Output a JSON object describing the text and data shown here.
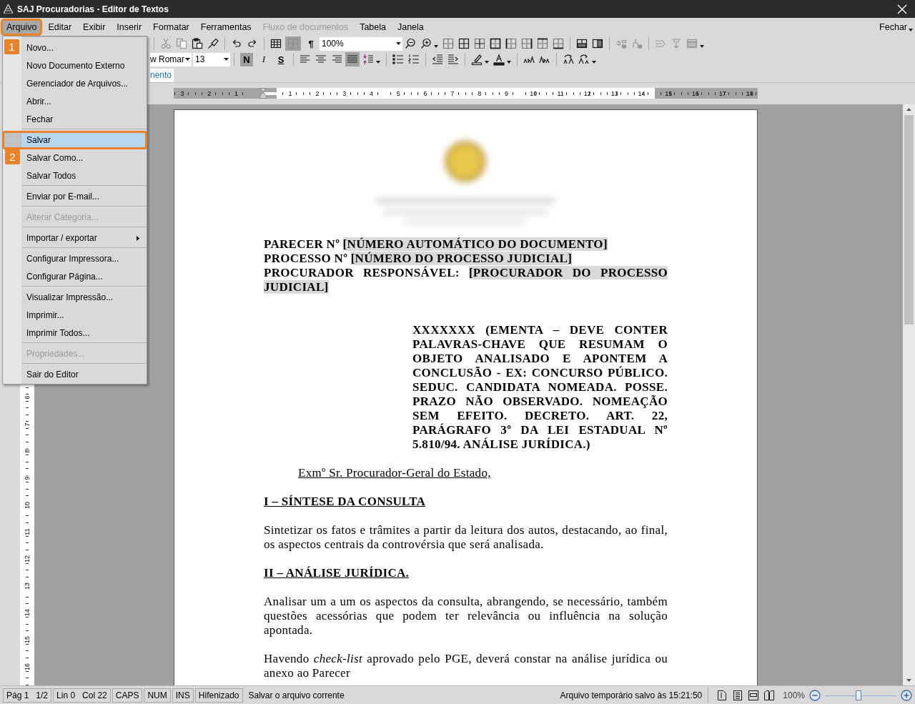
{
  "window": {
    "title": "SAJ Procuradorias - Editor de Textos"
  },
  "menus": [
    {
      "label": "Arquivo",
      "selected": true,
      "disabled": false,
      "callout": "1"
    },
    {
      "label": "Editar",
      "selected": false,
      "disabled": false
    },
    {
      "label": "Exibir",
      "selected": false,
      "disabled": false
    },
    {
      "label": "Inserir",
      "selected": false,
      "disabled": false
    },
    {
      "label": "Formatar",
      "selected": false,
      "disabled": false
    },
    {
      "label": "Ferramentas",
      "selected": false,
      "disabled": false
    },
    {
      "label": "Fluxo de documentos",
      "selected": false,
      "disabled": true
    },
    {
      "label": "Tabela",
      "selected": false,
      "disabled": false
    },
    {
      "label": "Janela",
      "selected": false,
      "disabled": false
    }
  ],
  "close_document": "Fechar",
  "file_menu": {
    "groups": [
      {
        "items": [
          {
            "label": "Novo...",
            "selected": false,
            "disabled": false,
            "submenu": false
          },
          {
            "label": "Novo Documento Externo",
            "selected": false,
            "disabled": false,
            "submenu": false
          },
          {
            "label": "Gerenciador de Arquivos...",
            "selected": false,
            "disabled": false,
            "submenu": false
          },
          {
            "label": "Abrir...",
            "selected": false,
            "disabled": false,
            "submenu": false
          },
          {
            "label": "Fechar",
            "selected": false,
            "disabled": false,
            "submenu": false
          }
        ]
      },
      {
        "items": [
          {
            "label": "Salvar",
            "selected": true,
            "disabled": false,
            "submenu": false,
            "callout": "2"
          },
          {
            "label": "Salvar Como...",
            "selected": false,
            "disabled": false,
            "submenu": false
          },
          {
            "label": "Salvar Todos",
            "selected": false,
            "disabled": false,
            "submenu": false
          }
        ]
      },
      {
        "items": [
          {
            "label": "Enviar por E-mail...",
            "selected": false,
            "disabled": false,
            "submenu": false
          }
        ]
      },
      {
        "items": [
          {
            "label": "Alterar Categoria...",
            "selected": false,
            "disabled": true,
            "submenu": false
          }
        ]
      },
      {
        "items": [
          {
            "label": "Importar / exportar",
            "selected": false,
            "disabled": false,
            "submenu": true
          }
        ]
      },
      {
        "items": [
          {
            "label": "Configurar Impressora...",
            "selected": false,
            "disabled": false,
            "submenu": false
          },
          {
            "label": "Configurar Página...",
            "selected": false,
            "disabled": false,
            "submenu": false
          }
        ]
      },
      {
        "items": [
          {
            "label": "Visualizar Impressão...",
            "selected": false,
            "disabled": false,
            "submenu": false
          },
          {
            "label": "Imprimir...",
            "selected": false,
            "disabled": false,
            "submenu": false
          },
          {
            "label": "Imprimir Todos...",
            "selected": false,
            "disabled": false,
            "submenu": false
          }
        ]
      },
      {
        "items": [
          {
            "label": "Propriedades...",
            "selected": false,
            "disabled": true,
            "submenu": false
          }
        ]
      },
      {
        "items": [
          {
            "label": "Sair do Editor",
            "selected": false,
            "disabled": false,
            "submenu": false
          }
        ]
      }
    ]
  },
  "toolbar": {
    "edit_buttons": [
      {
        "disabled": true
      },
      {
        "disabled": true
      },
      {
        "disabled": false
      },
      {
        "disabled": false
      }
    ],
    "grid_button": {
      "pressed": true
    },
    "pilcrow": {
      "label": "¶",
      "pressed": false
    },
    "zoom": "100%",
    "table_tools": [
      {
        "disabled": false
      },
      {
        "disabled": false
      },
      {
        "disabled": false
      },
      {
        "disabled": false
      },
      {
        "disabled": false
      },
      {
        "disabled": false
      },
      {
        "disabled": false
      },
      {
        "disabled": false
      },
      {
        "disabled": false
      },
      {
        "disabled": false
      },
      {
        "disabled": true
      },
      {
        "disabled": true
      },
      {
        "disabled": true
      },
      {
        "disabled": true
      },
      {
        "disabled": true
      }
    ],
    "font": "w Romar",
    "size": "13",
    "format_buttons": [
      {
        "label": "N",
        "pressed": true
      },
      {
        "label": "I",
        "pressed": false
      },
      {
        "label": "S",
        "pressed": false
      }
    ],
    "align_buttons": [
      {
        "selected": false
      },
      {
        "selected": false
      },
      {
        "selected": false
      },
      {
        "selected": true
      }
    ],
    "tab": "nento"
  },
  "ruler": {
    "labels": [
      {
        "label": "3",
        "margin": true
      },
      {
        "label": "2",
        "margin": true
      },
      {
        "label": "1",
        "margin": true
      },
      {
        "label": "1",
        "margin": false
      },
      {
        "label": "2",
        "margin": false
      },
      {
        "label": "3",
        "margin": false
      },
      {
        "label": "4",
        "margin": false
      },
      {
        "label": "5",
        "margin": false
      },
      {
        "label": "6",
        "margin": false
      },
      {
        "label": "7",
        "margin": false
      },
      {
        "label": "8",
        "margin": false
      },
      {
        "label": "9",
        "margin": false
      },
      {
        "label": "10",
        "margin": false
      },
      {
        "label": "11",
        "margin": false
      },
      {
        "label": "12",
        "margin": false
      },
      {
        "label": "13",
        "margin": false
      },
      {
        "label": "14",
        "margin": false
      },
      {
        "label": "15",
        "margin": true
      },
      {
        "label": "16",
        "margin": true
      },
      {
        "label": "17",
        "margin": true
      },
      {
        "label": "18",
        "margin": true
      }
    ]
  },
  "vertical_ruler": {
    "labels": [
      "6",
      "7",
      "8",
      "9",
      "10",
      "11",
      "12",
      "13",
      "14",
      "15",
      "16"
    ]
  },
  "document": {
    "blocks": [
      {
        "kind": "header",
        "parts": [
          {
            "text": "PARECER Nº ",
            "field": false
          },
          {
            "text": "[NÚMERO AUTOMÁTICO DO DOCUMENTO]",
            "field": true
          }
        ]
      },
      {
        "kind": "header",
        "parts": [
          {
            "text": "PROCESSO Nº ",
            "field": false
          },
          {
            "text": "[NÚMERO DO PROCESSO JUDICIAL]",
            "field": true
          }
        ]
      },
      {
        "kind": "header",
        "parts": [
          {
            "text": "PROCURADOR RESPONSÁVEL: ",
            "field": false
          },
          {
            "text": "[PROCURADOR DO PROCESSO JUDICIAL]",
            "field": true
          }
        ]
      },
      {
        "kind": "ementa",
        "text": "XXXXXXX (EMENTA – DEVE CONTER PALAVRAS-CHAVE QUE RESUMAM O OBJETO ANALISADO E APONTEM A CONCLUSÃO - EX: CONCURSO PÚBLICO. SEDUC. CANDIDATA NOMEADA. POSSE. PRAZO NÃO OBSERVADO. NOMEAÇÃO SEM EFEITO. DECRETO. ART. 22, PARÁGRAFO 3º DA LEI ESTADUAL Nº 5.810/94. ANÁLISE JURÍDICA.)"
      },
      {
        "kind": "salutation",
        "text": "Exmº Sr. Procurador-Geral do Estado,"
      },
      {
        "kind": "section",
        "text": "I – SÍNTESE DA CONSULTA"
      },
      {
        "kind": "body",
        "text": "Sintetizar os fatos e trâmites a partir da leitura dos autos, destacando, ao final, os aspectos centrais da controvérsia que será analisada."
      },
      {
        "kind": "section",
        "text": "II – ANÁLISE JURÍDICA."
      },
      {
        "kind": "body",
        "text": "Analisar um a um os aspectos da consulta, abrangendo, se necessário, também questões acessórias que podem ter relevância ou influência na solução apontada."
      },
      {
        "kind": "body",
        "text": "Havendo *check-list* aprovado pelo PGE, deverá constar na análise jurídica ou anexo ao Parecer"
      }
    ]
  },
  "status_bar": {
    "panels": [
      {
        "items": [
          "Pág 1",
          "1/2"
        ]
      },
      {
        "items": [
          "Lin 0",
          "Col 22"
        ]
      },
      {
        "items": [
          "CAPS"
        ]
      },
      {
        "items": [
          "NUM"
        ]
      },
      {
        "items": [
          "INS"
        ]
      },
      {
        "items": [
          "Hifenizado"
        ]
      }
    ],
    "message": "Salvar o arquivo corrente",
    "autosave": "Arquivo temporário salvo às 15:21:50",
    "zoom": {
      "reading": "100%",
      "level": 0.47
    }
  }
}
